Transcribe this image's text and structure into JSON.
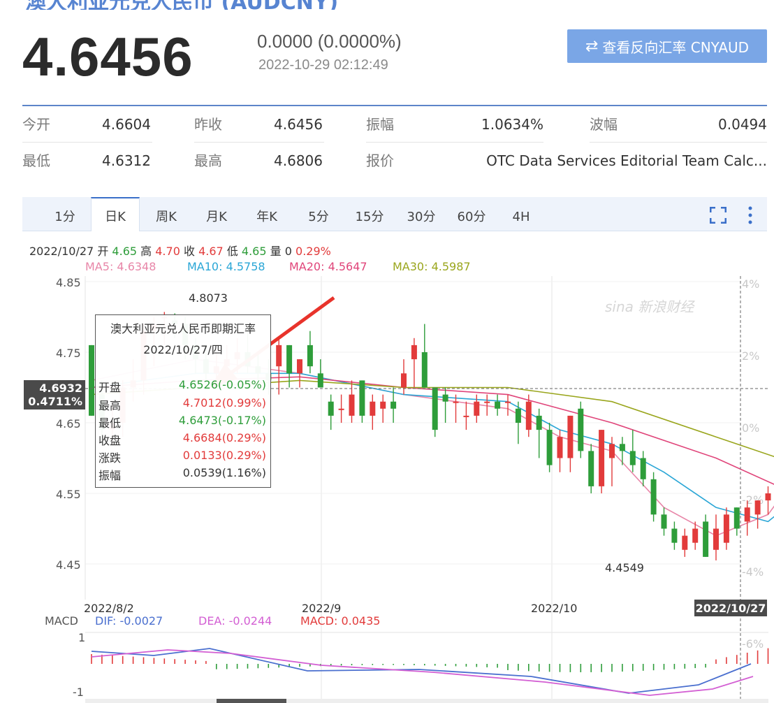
{
  "quote": {
    "price": "4.6456",
    "change": "0.0000 (0.0000%)",
    "timestamp": "2022-10-29 02:12:49",
    "reverse_button_label": "查看反向汇率 CNYAUD"
  },
  "stats": [
    [
      {
        "label": "今开",
        "value": "4.6604"
      },
      {
        "label": "昨收",
        "value": "4.6456"
      },
      {
        "label": "振幅",
        "value": "1.0634%"
      },
      {
        "label": "波幅",
        "value": "0.0494"
      }
    ],
    [
      {
        "label": "最低",
        "value": "4.6312"
      },
      {
        "label": "最高",
        "value": "4.6806"
      },
      {
        "label": "报价",
        "value": "OTC Data Services Editorial Team Calc..."
      }
    ]
  ],
  "tabs": [
    {
      "label": "1分",
      "active": false
    },
    {
      "label": "日K",
      "active": true
    },
    {
      "label": "周K",
      "active": false
    },
    {
      "label": "月K",
      "active": false
    },
    {
      "label": "年K",
      "active": false
    },
    {
      "label": "5分",
      "active": false
    },
    {
      "label": "15分",
      "active": false
    },
    {
      "label": "30分",
      "active": false
    },
    {
      "label": "60分",
      "active": false
    },
    {
      "label": "4H",
      "active": false
    }
  ],
  "icons": {
    "fullscreen": "fullscreen-icon",
    "menu": "more-vertical-icon",
    "swap": "swap-arrows-icon"
  },
  "candle_info": {
    "date": "2022/10/27",
    "open_label": "开",
    "open": "4.65",
    "high_label": "高",
    "high": "4.70",
    "close_label": "收",
    "close": "4.67",
    "low_label": "低",
    "low": "4.65",
    "vol_label": "量",
    "vol": "0",
    "pct": "0.29%"
  },
  "ma": [
    {
      "name": "MA5",
      "value": "4.6348",
      "color": "#e886a8"
    },
    {
      "name": "MA10",
      "value": "4.5758",
      "color": "#2aa6d6"
    },
    {
      "name": "MA20",
      "value": "4.5647",
      "color": "#e0457a"
    },
    {
      "name": "MA30",
      "value": "4.5987",
      "color": "#9aa61d"
    }
  ],
  "tooltip": {
    "title": "澳大利亚元兑人民币即期汇率",
    "date": "2022/10/27/四",
    "rows": [
      {
        "label": "开盘",
        "value": "4.6526(-0.05%)",
        "color": "#2e9d3a"
      },
      {
        "label": "最高",
        "value": "4.7012(0.99%)",
        "color": "#e23b3b"
      },
      {
        "label": "最低",
        "value": "4.6473(-0.17%)",
        "color": "#2e9d3a"
      },
      {
        "label": "收盘",
        "value": "4.6684(0.29%)",
        "color": "#e23b3b"
      },
      {
        "label": "涨跌",
        "value": "0.0133(0.29%)",
        "color": "#e23b3b"
      },
      {
        "label": "振幅",
        "value": "0.0539(1.16%)",
        "color": "#333333"
      }
    ]
  },
  "watermark": "sina 新浪财经",
  "macd": {
    "label": "MACD",
    "dif": "DIF: -0.0027",
    "dea": "DEA: -0.0244",
    "macd": "MACD: 0.0435",
    "y_top": "1",
    "y_bottom": "-1"
  },
  "chart_data": {
    "type": "candlestick",
    "y_ticks": [
      "4.85",
      "4.75",
      "4.65",
      "4.55",
      "4.45"
    ],
    "right_ticks": [
      "4%",
      "2%",
      "0%",
      "-2%",
      "-4%",
      "-6%"
    ],
    "x_labels": [
      "2022/8/2",
      "2022/9",
      "2022/10",
      "2022/10/27"
    ],
    "crosshair": {
      "price": "4.6932",
      "pct": "0.4711%"
    },
    "annotations": {
      "high": "4.8073",
      "low": "4.4549"
    },
    "candles": [
      [
        4.76,
        4.76,
        4.66,
        4.66
      ],
      [
        4.69,
        4.71,
        4.62,
        4.64
      ],
      [
        4.64,
        4.68,
        4.62,
        4.65
      ],
      [
        4.65,
        4.71,
        4.63,
        4.7
      ],
      [
        4.7,
        4.74,
        4.68,
        4.71
      ],
      [
        4.71,
        4.79,
        4.69,
        4.78
      ],
      [
        4.78,
        4.8,
        4.73,
        4.79
      ],
      [
        4.8,
        4.807,
        4.76,
        4.8
      ],
      [
        4.795,
        4.805,
        4.77,
        4.79
      ],
      [
        4.79,
        4.8,
        4.74,
        4.76
      ],
      [
        4.76,
        4.77,
        4.72,
        4.74
      ],
      [
        4.74,
        4.76,
        4.7,
        4.72
      ],
      [
        4.72,
        4.75,
        4.7,
        4.73
      ],
      [
        4.73,
        4.76,
        4.71,
        4.74
      ],
      [
        4.74,
        4.77,
        4.72,
        4.75
      ],
      [
        4.75,
        4.78,
        4.72,
        4.73
      ],
      [
        4.73,
        4.75,
        4.7,
        4.72
      ],
      [
        4.72,
        4.74,
        4.69,
        4.71
      ],
      [
        4.73,
        4.77,
        4.69,
        4.76
      ],
      [
        4.76,
        4.76,
        4.7,
        4.72
      ],
      [
        4.72,
        4.74,
        4.7,
        4.74
      ],
      [
        4.76,
        4.78,
        4.72,
        4.73
      ],
      [
        4.72,
        4.74,
        4.7,
        4.7
      ],
      [
        4.68,
        4.69,
        4.64,
        4.66
      ],
      [
        4.67,
        4.69,
        4.65,
        4.67
      ],
      [
        4.66,
        4.71,
        4.65,
        4.69
      ],
      [
        4.71,
        4.71,
        4.65,
        4.66
      ],
      [
        4.66,
        4.69,
        4.64,
        4.68
      ],
      [
        4.67,
        4.69,
        4.65,
        4.68
      ],
      [
        4.68,
        4.7,
        4.65,
        4.67
      ],
      [
        4.7,
        4.74,
        4.69,
        4.72
      ],
      [
        4.74,
        4.77,
        4.7,
        4.76
      ],
      [
        4.75,
        4.79,
        4.7,
        4.7
      ],
      [
        4.7,
        4.7,
        4.63,
        4.64
      ],
      [
        4.69,
        4.7,
        4.65,
        4.68
      ],
      [
        4.68,
        4.69,
        4.65,
        4.68
      ],
      [
        4.66,
        4.68,
        4.64,
        4.66
      ],
      [
        4.66,
        4.69,
        4.65,
        4.68
      ],
      [
        4.68,
        4.69,
        4.66,
        4.68
      ],
      [
        4.68,
        4.69,
        4.66,
        4.67
      ],
      [
        4.68,
        4.69,
        4.66,
        4.68
      ],
      [
        4.67,
        4.68,
        4.62,
        4.65
      ],
      [
        4.64,
        4.69,
        4.63,
        4.68
      ],
      [
        4.66,
        4.67,
        4.6,
        4.64
      ],
      [
        4.64,
        4.65,
        4.58,
        4.59
      ],
      [
        4.6,
        4.64,
        4.58,
        4.63
      ],
      [
        4.6,
        4.66,
        4.58,
        4.66
      ],
      [
        4.67,
        4.68,
        4.6,
        4.61
      ],
      [
        4.61,
        4.62,
        4.55,
        4.56
      ],
      [
        4.56,
        4.64,
        4.55,
        4.64
      ],
      [
        4.6,
        4.63,
        4.56,
        4.62
      ],
      [
        4.62,
        4.63,
        4.59,
        4.61
      ],
      [
        4.61,
        4.64,
        4.58,
        4.59
      ],
      [
        4.6,
        4.61,
        4.56,
        4.57
      ],
      [
        4.57,
        4.58,
        4.51,
        4.52
      ],
      [
        4.52,
        4.53,
        4.49,
        4.5
      ],
      [
        4.5,
        4.51,
        4.47,
        4.48
      ],
      [
        4.47,
        4.5,
        4.46,
        4.49
      ],
      [
        4.48,
        4.51,
        4.47,
        4.5
      ],
      [
        4.51,
        4.52,
        4.46,
        4.46
      ],
      [
        4.47,
        4.52,
        4.455,
        4.5
      ],
      [
        4.48,
        4.53,
        4.47,
        4.52
      ],
      [
        4.53,
        4.53,
        4.49,
        4.5
      ],
      [
        4.51,
        4.54,
        4.49,
        4.53
      ],
      [
        4.52,
        4.54,
        4.5,
        4.54
      ],
      [
        4.54,
        4.56,
        4.52,
        4.55
      ],
      [
        4.53,
        4.62,
        4.51,
        4.61
      ],
      [
        4.61,
        4.64,
        4.6,
        4.64
      ],
      [
        4.64,
        4.68,
        4.61,
        4.62
      ],
      [
        4.64,
        4.7,
        4.63,
        4.65
      ],
      [
        4.65,
        4.69,
        4.64,
        4.67
      ],
      [
        4.665,
        4.7,
        4.647,
        4.668
      ]
    ],
    "ma_series": {
      "MA5": [
        [
          0,
          4.71
        ],
        [
          10,
          4.74
        ],
        [
          20,
          4.72
        ],
        [
          30,
          4.69
        ],
        [
          40,
          4.67
        ],
        [
          45,
          4.63
        ],
        [
          50,
          4.61
        ],
        [
          55,
          4.53
        ],
        [
          60,
          4.49
        ],
        [
          65,
          4.52
        ],
        [
          70,
          4.62
        ],
        [
          71,
          4.635
        ]
      ],
      "MA10": [
        [
          0,
          4.7
        ],
        [
          10,
          4.72
        ],
        [
          20,
          4.72
        ],
        [
          30,
          4.69
        ],
        [
          40,
          4.68
        ],
        [
          45,
          4.64
        ],
        [
          50,
          4.62
        ],
        [
          55,
          4.58
        ],
        [
          60,
          4.53
        ],
        [
          65,
          4.51
        ],
        [
          70,
          4.57
        ],
        [
          71,
          4.576
        ]
      ],
      "MA20": [
        [
          0,
          4.7
        ],
        [
          10,
          4.71
        ],
        [
          20,
          4.715
        ],
        [
          30,
          4.7
        ],
        [
          40,
          4.69
        ],
        [
          50,
          4.65
        ],
        [
          60,
          4.6
        ],
        [
          66,
          4.56
        ],
        [
          70,
          4.56
        ],
        [
          71,
          4.565
        ]
      ],
      "MA30": [
        [
          0,
          4.69
        ],
        [
          10,
          4.7
        ],
        [
          20,
          4.71
        ],
        [
          30,
          4.7
        ],
        [
          40,
          4.7
        ],
        [
          50,
          4.68
        ],
        [
          60,
          4.63
        ],
        [
          66,
          4.6
        ],
        [
          70,
          4.595
        ],
        [
          71,
          4.599
        ]
      ]
    }
  }
}
